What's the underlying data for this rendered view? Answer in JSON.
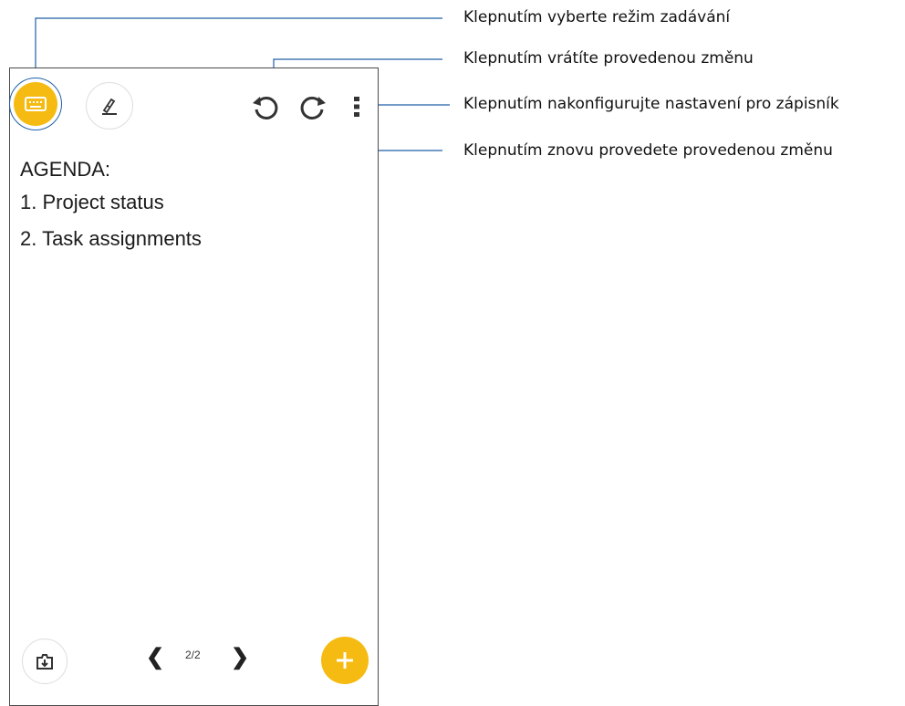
{
  "toolbar": {
    "input_mode_icon": "keyboard-icon",
    "handwriting_icon": "pen-icon",
    "undo_icon": "undo-icon",
    "redo_icon": "redo-icon",
    "menu_icon": "more-vertical-icon"
  },
  "note": {
    "lines": [
      "AGENDA:",
      "1. Project status",
      "2. Task assignments"
    ]
  },
  "bottom": {
    "import_icon": "import-page-icon",
    "prev_icon": "chevron-left-icon",
    "next_icon": "chevron-right-icon",
    "page_indicator": "2/2",
    "add_icon": "plus-icon"
  },
  "callouts": {
    "input_mode": "Klepnutím vyberte režim zadávání",
    "undo": "Klepnutím vrátíte provedenou změnu",
    "settings": "Klepnutím nakonfigurujte nastavení pro zápisník",
    "redo": "Klepnutím znovu provedete provedenou změnu"
  },
  "colors": {
    "accent": "#f5bb12",
    "callout_line": "#1f5fa8"
  }
}
